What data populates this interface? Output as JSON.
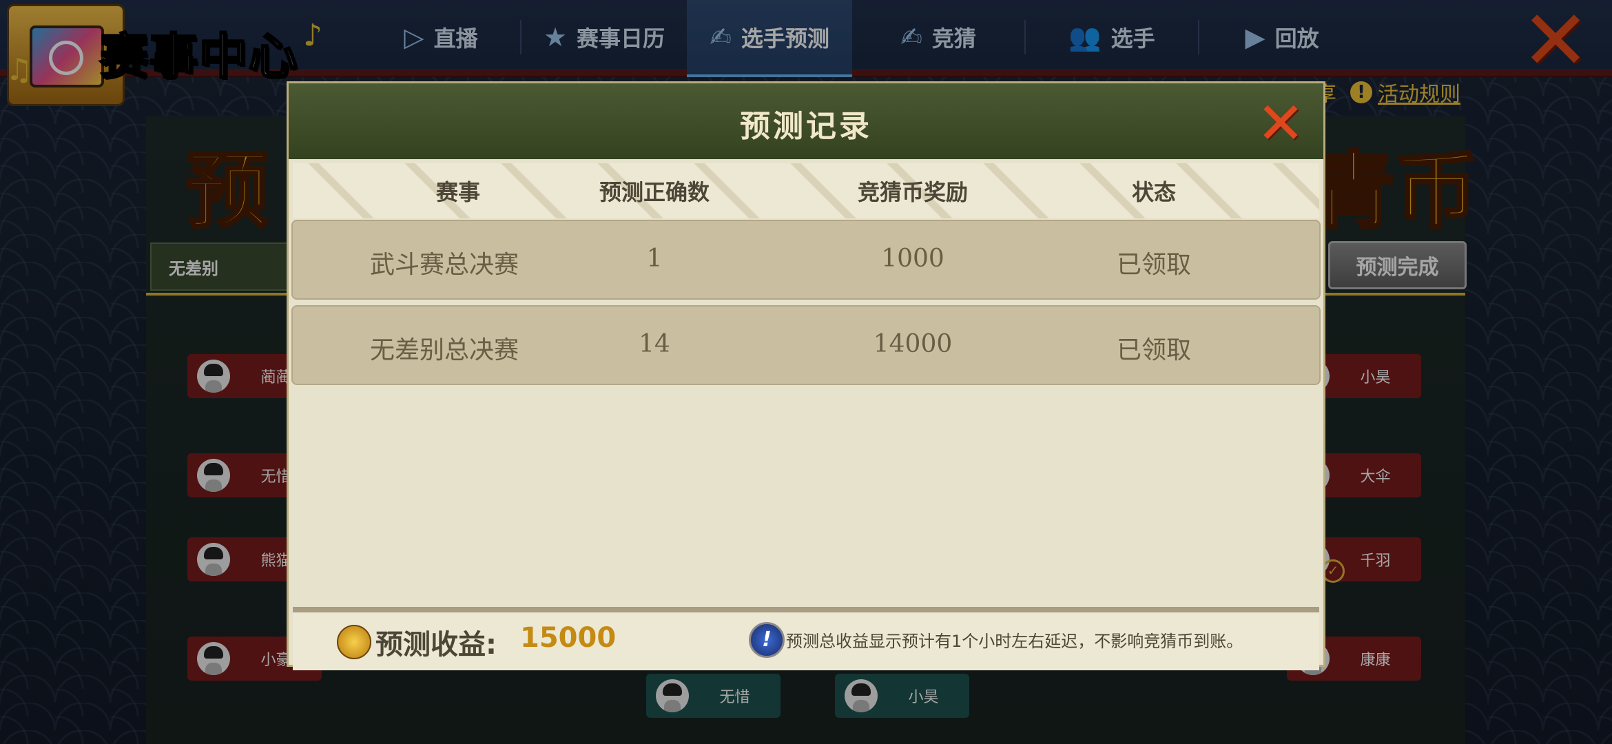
{
  "app": {
    "title": "赛事中心"
  },
  "nav": {
    "tabs": [
      {
        "label": "直播",
        "icon": "tv-icon"
      },
      {
        "label": "赛事日历",
        "icon": "star-icon"
      },
      {
        "label": "选手预测",
        "icon": "predict-icon",
        "active": true
      },
      {
        "label": "竞猜",
        "icon": "bet-icon"
      },
      {
        "label": "选手",
        "icon": "players-icon"
      },
      {
        "label": "回放",
        "icon": "video-camera-icon"
      }
    ]
  },
  "background": {
    "banner_left": "预",
    "banner_right": "青币",
    "left_tab": "无差别",
    "rules_prefix": "享",
    "rules_link": "活动规则",
    "done_button": "预测完成",
    "players_left": [
      "蔺蔺",
      "无惜",
      "熊猫",
      "小豪"
    ],
    "players_right": [
      "小昊",
      "大伞",
      "千羽",
      "康康"
    ],
    "players_bottom": [
      "无惜",
      "小昊"
    ]
  },
  "dialog": {
    "title": "预测记录",
    "columns": [
      "赛事",
      "预测正确数",
      "竞猜币奖励",
      "状态"
    ],
    "rows": [
      {
        "event": "武斗赛总决赛",
        "correct": "1",
        "reward": "1000",
        "status": "已领取"
      },
      {
        "event": "无差别总决赛",
        "correct": "14",
        "reward": "14000",
        "status": "已领取"
      }
    ],
    "footer": {
      "earnings_label": "预测收益:",
      "earnings_value": "15000",
      "note": "预测总收益显示预计有1个小时左右延迟，不影响竞猜币到账。"
    }
  },
  "colors": {
    "accent_gold": "#c48a12",
    "close_red": "#e0471c",
    "header_green": "#4b5a33"
  }
}
